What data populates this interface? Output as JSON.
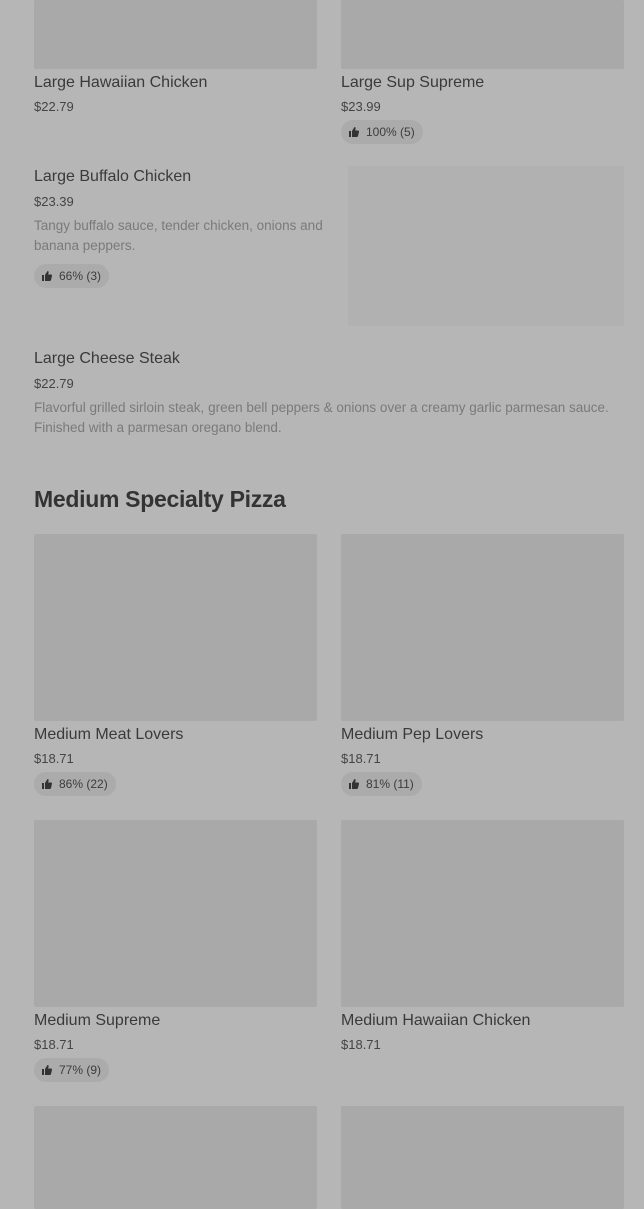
{
  "items": {
    "large_hawaiian": {
      "name": "Large Hawaiian Chicken",
      "price": "$22.79"
    },
    "large_sup_supreme": {
      "name": "Large Sup Supreme",
      "price": "$23.99",
      "rating": "100% (5)"
    },
    "large_buffalo": {
      "name": "Large Buffalo Chicken",
      "price": "$23.39",
      "description": "Tangy buffalo sauce, tender chicken, onions and banana peppers.",
      "rating": "66% (3)"
    },
    "large_cheese_steak": {
      "name": "Large Cheese Steak",
      "price": "$22.79",
      "description": "Flavorful grilled sirloin steak, green bell peppers & onions over a creamy garlic parmesan sauce. Finished with a parmesan oregano blend."
    },
    "medium_meat_lovers": {
      "name": "Medium Meat Lovers",
      "price": "$18.71",
      "rating": "86% (22)"
    },
    "medium_pep_lovers": {
      "name": "Medium Pep Lovers",
      "price": "$18.71",
      "rating": "81% (11)"
    },
    "medium_supreme": {
      "name": "Medium Supreme",
      "price": "$18.71",
      "rating": "77% (9)"
    },
    "medium_hawaiian": {
      "name": "Medium Hawaiian Chicken",
      "price": "$18.71"
    }
  },
  "sections": {
    "medium_specialty": {
      "title": "Medium Specialty Pizza"
    }
  },
  "icons": {
    "rating": "thumbs-up-icon"
  }
}
